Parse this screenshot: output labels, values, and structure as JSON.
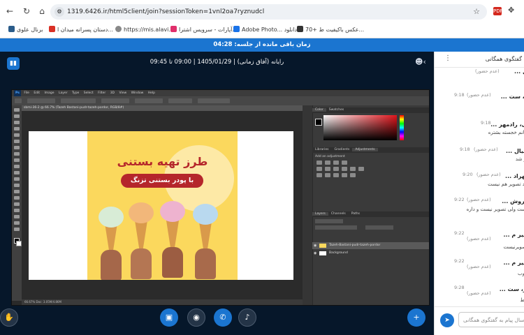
{
  "browser": {
    "url": "1319.6426.ir/html5client/join?sessionToken=1vnl2oa7ryznudcl",
    "bookmarks": [
      {
        "label": "برنال علوی"
      },
      {
        "label": "دستان پسرانه میدان ا..."
      },
      {
        "label": "https://mis.alavi.ir"
      },
      {
        "label": "آپارات - سرویس اشترا..."
      },
      {
        "label": "Adobe Photo... دانلود"
      },
      {
        "label": "70+ عکس باکیفیت ط..."
      }
    ],
    "pdf_ext_label": "PDF"
  },
  "session": {
    "time_remaining": "زمان باقی مانده از جلسه: 04:28",
    "title": "رایانه (آفاق زمانی) | 1405/01/29 | 09:00 تا 09:45"
  },
  "photoshop": {
    "menu": [
      "File",
      "Edit",
      "Image",
      "Layer",
      "Type",
      "Select",
      "Filter",
      "3D",
      "View",
      "Window",
      "Help"
    ],
    "doc_tab": "sbmi-36-2 @ 66.7% (Tazeh Bastani-pudr-tazeh-pordor, RGB/8#)",
    "status": "66.67%   Doc: 3.05M/4.86M",
    "poster_title": "طرز تهیه بستنی",
    "poster_subtitle": "با پودر بستنی تزنگ",
    "panel_tabs_color": [
      "Color",
      "Swatches"
    ],
    "panel_tabs_adjust": [
      "Libraries",
      "Gradients",
      "Adjustments"
    ],
    "adjust_hint": "Add an adjustment",
    "panel_tabs_layers": [
      "Layers",
      "Channels",
      "Paths"
    ],
    "layers": [
      {
        "name": "Tazeh-Bastani-pudr-tazeh-pordor"
      },
      {
        "name": "Background"
      }
    ]
  },
  "chat": {
    "title": "گفتگوی همگانی",
    "messages": [
      {
        "name": "... دانیال",
        "status": "(عدم حضور)",
        "time": "",
        "text": ""
      },
      {
        "name": "... فر، ست",
        "status": "(عدم حضور)",
        "time": "9:18",
        "text": ""
      },
      {
        "name": "... بهی، رادمهر",
        "status": "",
        "time": "9:18",
        "text": "حانم خجسته بشتره"
      },
      {
        "name": "... دانیال",
        "status": "(عدم حضور)",
        "time": "9:18",
        "text": "ر شد"
      },
      {
        "name": "... مهراد",
        "status": "(عدم حضور)",
        "time": "9:20",
        "text": "یاد تصویر هم نیست"
      },
      {
        "name": "... سروش",
        "status": "(عدم حضور)",
        "time": "9:22",
        "text": "هست ولی تصویر نیست و داره"
      },
      {
        "name": "... امیر م",
        "status": "(عدم حضور)",
        "time": "9:22",
        "text": "صویرنیست"
      },
      {
        "name": "... امیر م",
        "status": "(عدم حضور)",
        "time": "9:22",
        "text": "وب"
      },
      {
        "name": "... فر، ست",
        "status": "(عدم حضور)",
        "time": "9:28",
        "text": "ط"
      }
    ],
    "input_placeholder": "ارسال پیام به گفتگوی همگانی"
  }
}
